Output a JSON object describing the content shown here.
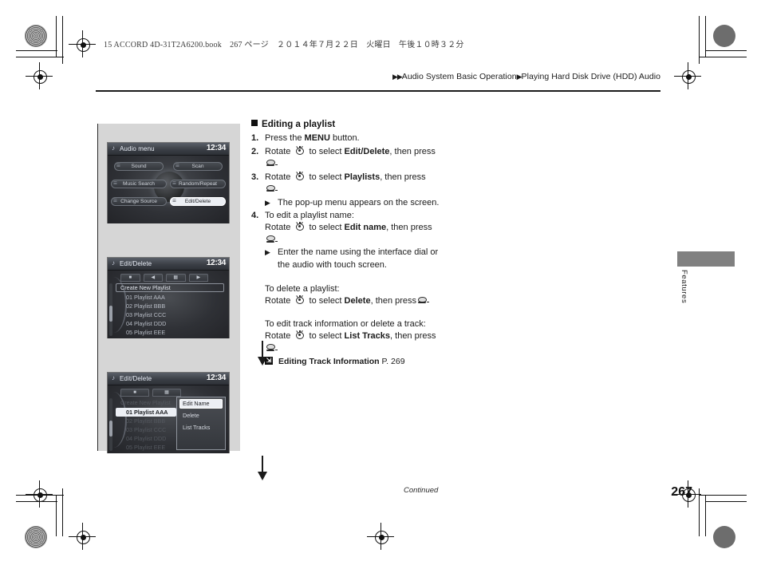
{
  "print_header": "15 ACCORD 4D-31T2A6200.book　267 ページ　２０１４年７月２２日　火曜日　午後１０時３２分",
  "breadcrumb": {
    "arrow_double": "▶▶",
    "arrow_single": "▶",
    "section": "Audio System Basic Operation",
    "subsection": "Playing Hard Disk Drive (HDD) Audio"
  },
  "content": {
    "heading": "Editing a playlist",
    "steps": [
      {
        "no": "1.",
        "pre": "Press the ",
        "bold": "MENU",
        "post": " button."
      },
      {
        "no": "2.",
        "pre": "Rotate ",
        "mid": " to select ",
        "bold": "Edit/Delete",
        "post": ", then press"
      },
      {
        "no": "3.",
        "pre": "Rotate ",
        "mid": " to select ",
        "bold": "Playlists",
        "post": ", then press"
      },
      {
        "no": "4.",
        "text": "To edit a playlist name:"
      }
    ],
    "step3_note": "The pop-up menu appears on the screen.",
    "step4_line": {
      "pre": "Rotate ",
      "mid": " to select ",
      "bold": "Edit name",
      "post": ", then press"
    },
    "step4_note_line1": "Enter the name using the interface dial or",
    "step4_note_line2": "the audio with touch screen.",
    "delete_title": "To delete a playlist:",
    "delete_line": {
      "pre": "Rotate ",
      "mid": " to select ",
      "bold": "Delete",
      "post": ", then press"
    },
    "tracks_title": "To edit track information or delete a track:",
    "tracks_line": {
      "pre": "Rotate ",
      "mid": " to select ",
      "bold": "List Tracks",
      "post": ", then press"
    },
    "xref": {
      "label": "Editing Track Information",
      "page": "P. 269"
    }
  },
  "screens": [
    {
      "title": "Audio menu",
      "clock": "12:34",
      "buttons": [
        {
          "label": "Sound",
          "icon": "lvl",
          "selected": false
        },
        {
          "label": "Scan",
          "icon": "scn",
          "selected": false
        },
        {
          "label": "Music Search",
          "icon": "src",
          "selected": false
        },
        {
          "label": "Random/Repeat",
          "icon": "rnd",
          "selected": false
        },
        {
          "label": "Change Source",
          "icon": "chs",
          "selected": false
        },
        {
          "label": "Edit/Delete",
          "icon": "edt",
          "selected": true
        }
      ]
    },
    {
      "title": "Edit/Delete",
      "clock": "12:34",
      "create_row": "Create New Playlist",
      "rows": [
        "01 Playlist AAA",
        "02 Playlist BBB",
        "03 Playlist CCC",
        "04 Playlist DDD",
        "05 Playlist EEE"
      ]
    },
    {
      "title": "Edit/Delete",
      "clock": "12:34",
      "create_row": "Create New Playlist",
      "rows": [
        "01 Playlist AAA",
        "02 Playlist BBB",
        "03 Playlist CCC",
        "04 Playlist DDD",
        "05 Playlist EEE"
      ],
      "popup": [
        {
          "label": "Edit Name",
          "selected": true
        },
        {
          "label": "Delete",
          "selected": false
        },
        {
          "label": "List Tracks",
          "selected": false
        }
      ]
    }
  ],
  "thumb_tab": "Features",
  "footer": {
    "continued": "Continued",
    "page_number": "267"
  },
  "colors": {
    "ink": "#1b1b1b",
    "panel_gray": "#d6d6d6",
    "tab_gray": "#808080",
    "screen_dark": "#2e2e2e",
    "highlight": "#eceff4"
  }
}
